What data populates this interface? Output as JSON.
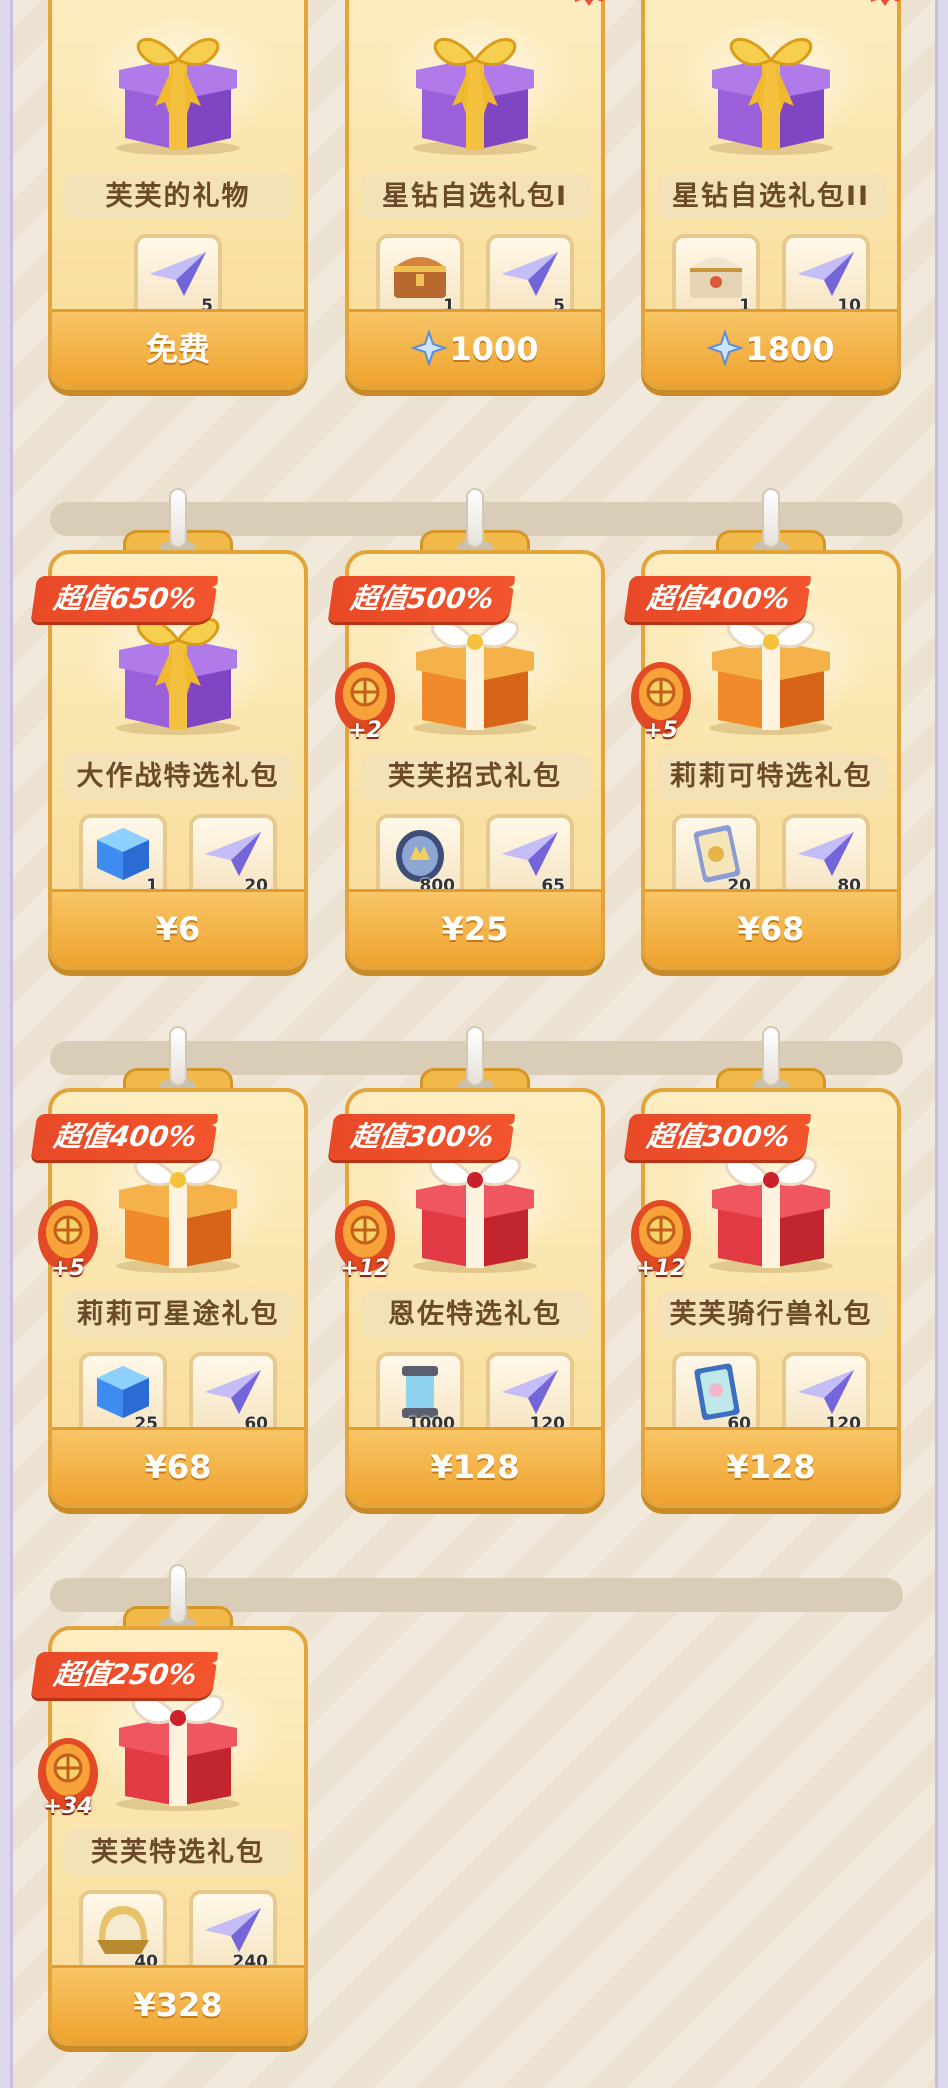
{
  "colors": {
    "price_bar": "#efa32f",
    "value_tag": "#e84a28",
    "hot_badge": "#e8523a",
    "card_border": "#e2a43b"
  },
  "cards": [
    {
      "name": "芙芙的礼物",
      "price": "免费",
      "price_icon": "",
      "hot": "",
      "notify_dot": true,
      "value_tag": "",
      "bonus": "",
      "gift": "purple",
      "items": [
        {
          "icon": "paper-plane-icon",
          "qty": "5"
        }
      ]
    },
    {
      "name": "星钻自选礼包I",
      "price": "1000",
      "price_icon": "star-diamond-icon",
      "hot": "热",
      "notify_dot": false,
      "value_tag": "",
      "bonus": "",
      "gift": "purple",
      "items": [
        {
          "icon": "treasure-chest-icon",
          "qty": "1"
        },
        {
          "icon": "paper-plane-icon",
          "qty": "5"
        }
      ]
    },
    {
      "name": "星钻自选礼包II",
      "price": "1800",
      "price_icon": "star-diamond-icon",
      "hot": "热",
      "notify_dot": false,
      "value_tag": "",
      "bonus": "",
      "gift": "purple",
      "items": [
        {
          "icon": "ornate-chest-icon",
          "qty": "1"
        },
        {
          "icon": "paper-plane-icon",
          "qty": "10"
        }
      ]
    },
    {
      "name": "大作战特选礼包",
      "price": "¥6",
      "price_icon": "",
      "hot": "",
      "notify_dot": false,
      "value_tag": "超值650%",
      "bonus": "",
      "gift": "purple",
      "items": [
        {
          "icon": "blue-cube-icon",
          "qty": "1"
        },
        {
          "icon": "paper-plane-icon",
          "qty": "20"
        }
      ]
    },
    {
      "name": "芙芙招式礼包",
      "price": "¥25",
      "price_icon": "",
      "hot": "",
      "notify_dot": false,
      "value_tag": "超值500%",
      "bonus": "+2",
      "gift": "orange",
      "items": [
        {
          "icon": "crystal-orb-icon",
          "qty": "800"
        },
        {
          "icon": "paper-plane-icon",
          "qty": "65"
        }
      ]
    },
    {
      "name": "莉莉可特选礼包",
      "price": "¥68",
      "price_icon": "",
      "hot": "",
      "notify_dot": false,
      "value_tag": "超值400%",
      "bonus": "+5",
      "gift": "orange",
      "items": [
        {
          "icon": "card-icon",
          "qty": "20"
        },
        {
          "icon": "paper-plane-icon",
          "qty": "80"
        }
      ]
    },
    {
      "name": "莉莉可星途礼包",
      "price": "¥68",
      "price_icon": "",
      "hot": "",
      "notify_dot": false,
      "value_tag": "超值400%",
      "bonus": "+5",
      "gift": "orange",
      "items": [
        {
          "icon": "blue-cube-icon",
          "qty": "25"
        },
        {
          "icon": "paper-plane-icon",
          "qty": "60"
        }
      ]
    },
    {
      "name": "恩佐特选礼包",
      "price": "¥128",
      "price_icon": "",
      "hot": "",
      "notify_dot": false,
      "value_tag": "超值300%",
      "bonus": "+12",
      "gift": "red",
      "items": [
        {
          "icon": "energy-cylinder-icon",
          "qty": "1000"
        },
        {
          "icon": "paper-plane-icon",
          "qty": "120"
        }
      ]
    },
    {
      "name": "芙芙骑行兽礼包",
      "price": "¥128",
      "price_icon": "",
      "hot": "",
      "notify_dot": false,
      "value_tag": "超值300%",
      "bonus": "+12",
      "gift": "red",
      "items": [
        {
          "icon": "mount-card-icon",
          "qty": "60"
        },
        {
          "icon": "paper-plane-icon",
          "qty": "120"
        }
      ]
    },
    {
      "name": "芙芙特选礼包",
      "price": "¥328",
      "price_icon": "",
      "hot": "",
      "notify_dot": false,
      "value_tag": "超值250%",
      "bonus": "+34",
      "gift": "red",
      "items": [
        {
          "icon": "golden-helmet-icon",
          "qty": "40"
        },
        {
          "icon": "paper-plane-icon",
          "qty": "240"
        }
      ]
    }
  ]
}
